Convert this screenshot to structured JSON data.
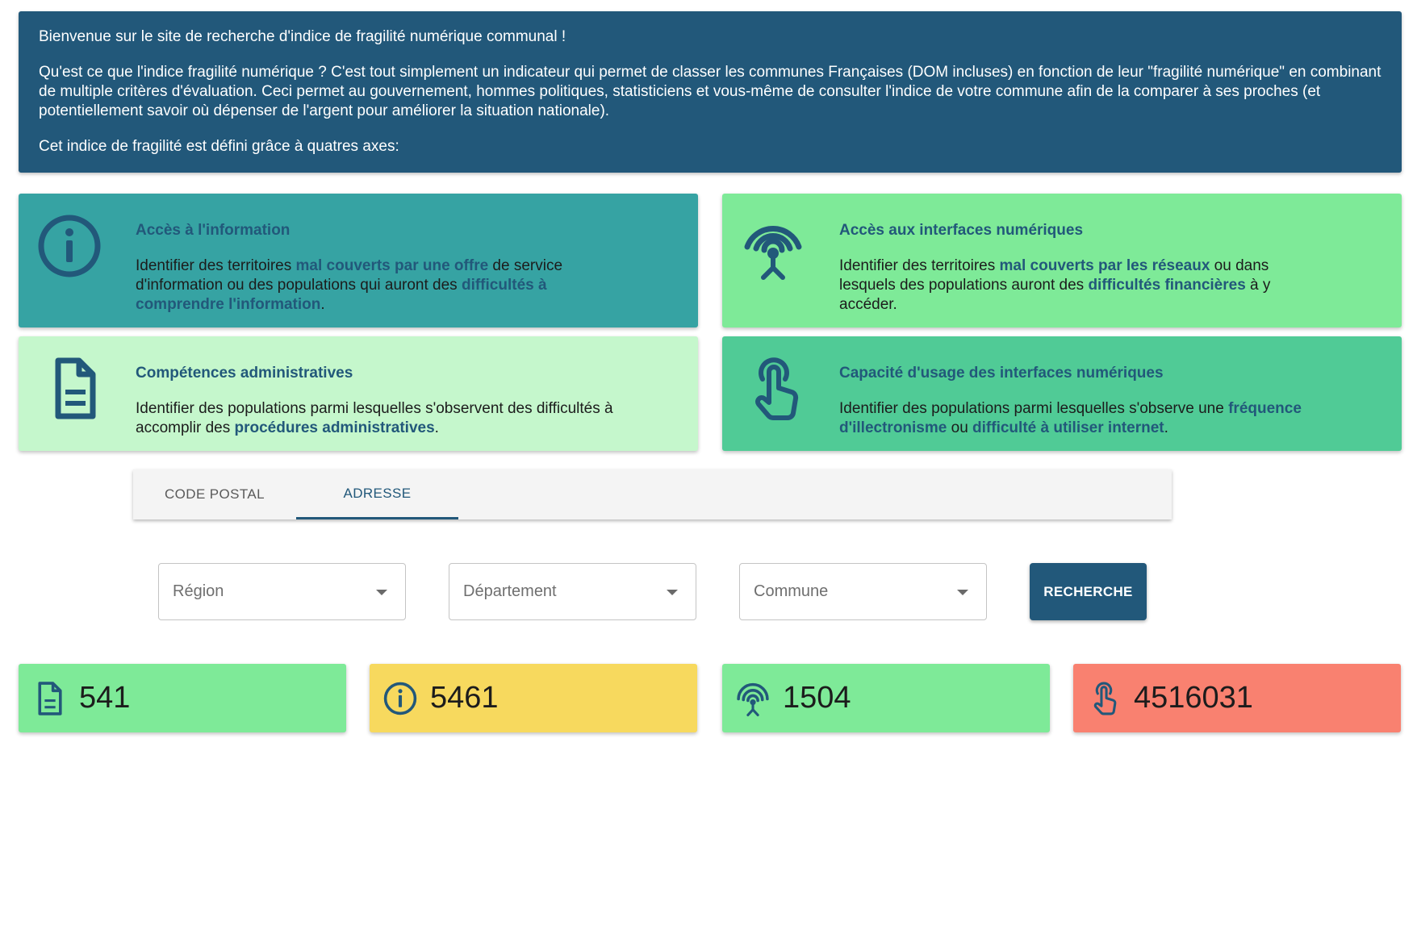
{
  "intro": {
    "welcome": "Bienvenue sur le site de recherche d'indice de fragilité numérique communal !",
    "description": "Qu'est ce que l'indice fragilité numérique ? C'est tout simplement un indicateur qui permet de classer les communes Françaises (DOM incluses) en fonction de leur \"fragilité numérique\" en combinant de multiple critères d'évaluation. Ceci permet au gouvernement, hommes politiques, statisticiens et vous-même de consulter l'indice de votre commune afin de la comparer à ses proches (et potentiellement savoir où dépenser de l'argent pour améliorer la situation nationale).",
    "axes_intro": "Cet indice de fragilité est défini grâce à quatres axes:"
  },
  "cards": {
    "info": {
      "title": "Accès à l'information",
      "icon": "info-icon",
      "t1": "Identifier des territoires ",
      "h1": "mal couverts par une offre",
      "t2": " de service d'information ou des populations qui auront des ",
      "h2": "difficultés à comprendre l'information",
      "t3": "."
    },
    "network": {
      "title": "Accès aux interfaces numériques",
      "icon": "antenna-icon",
      "t1": "Identifier des territoires ",
      "h1": "mal couverts par les réseaux",
      "t2": " ou dans lesquels des populations auront des ",
      "h2": "difficultés financières",
      "t3": " à y accéder."
    },
    "admin": {
      "title": "Compétences administratives",
      "icon": "document-icon",
      "t1": "Identifier des populations parmi lesquelles s'observent des difficultés à accomplir des ",
      "h1": "procédures administratives",
      "t2": "."
    },
    "usage": {
      "title": "Capacité d'usage des interfaces numériques",
      "icon": "touch-icon",
      "t1": "Identifier des populations parmi lesquelles s'observe une ",
      "h1": "fréquence d'illectronisme",
      "t2": " ou ",
      "h2": "difficulté à utiliser internet",
      "t3": "."
    }
  },
  "tabs": [
    {
      "label": "Code postal",
      "active": false
    },
    {
      "label": "Adresse",
      "active": true
    }
  ],
  "selects": {
    "region": "Région",
    "departement": "Département",
    "commune": "Commune"
  },
  "search_button": "Recherche",
  "stats": [
    {
      "icon": "document-icon",
      "value": "541",
      "color": "#7eea98"
    },
    {
      "icon": "info-icon",
      "value": "5461",
      "color": "#f7d95e"
    },
    {
      "icon": "antenna-icon",
      "value": "1504",
      "color": "#7eea98"
    },
    {
      "icon": "touch-icon",
      "value": "4516031",
      "color": "#f98170"
    }
  ],
  "colors": {
    "primary": "#22587a",
    "info_card": "#36a3a3",
    "network_card": "#7eea98",
    "admin_card": "#c5f7cc",
    "usage_card": "#50cb96"
  }
}
